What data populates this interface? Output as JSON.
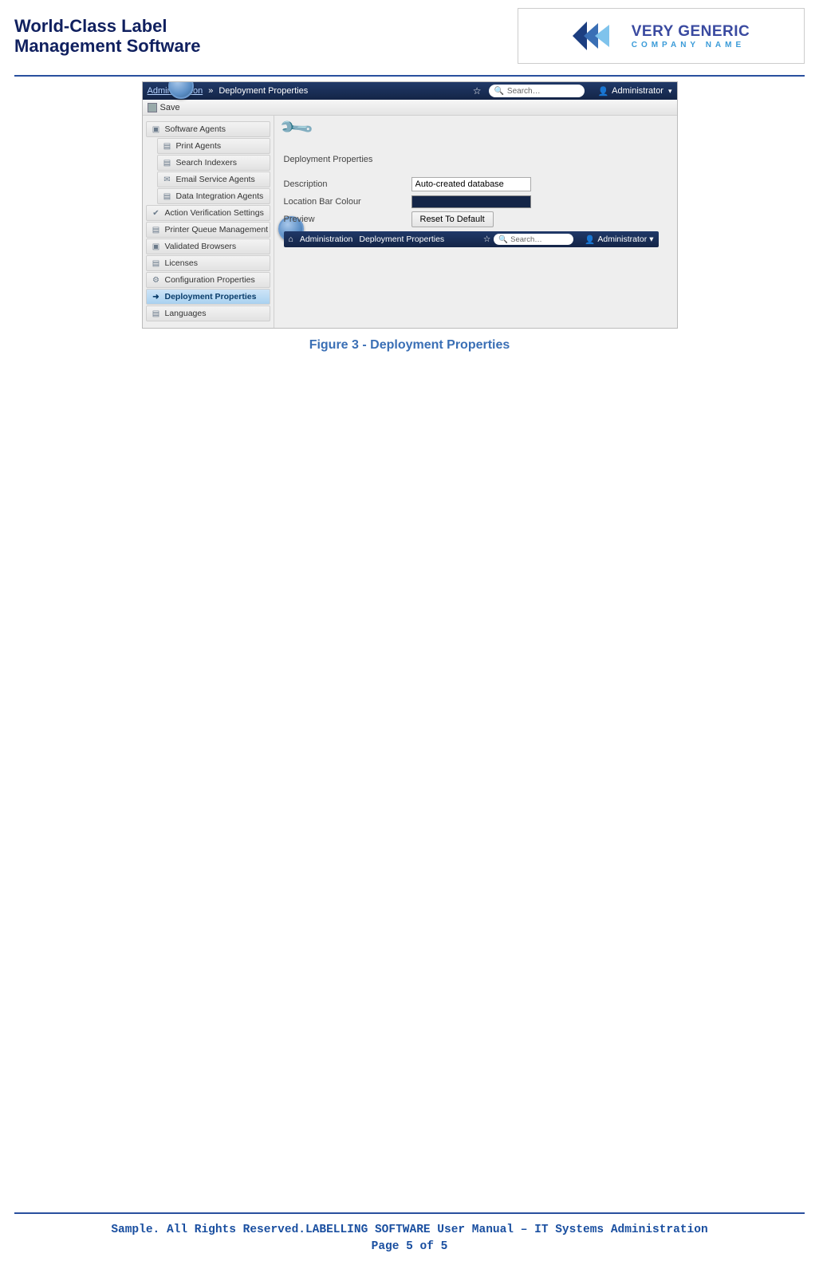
{
  "header": {
    "title_line1": "World-Class Label",
    "title_line2": "Management Software",
    "logo_line1": "VERY GENERIC",
    "logo_line2": "COMPANY NAME"
  },
  "screenshot": {
    "breadcrumb_admin": "Administration",
    "breadcrumb_current": "Deployment Properties",
    "search_placeholder": "Search…",
    "admin_label": "Administrator",
    "save_label": "Save",
    "sidebar": {
      "software_agents": "Software Agents",
      "print_agents": "Print Agents",
      "search_indexers": "Search Indexers",
      "email_service": "Email Service Agents",
      "data_integration": "Data Integration Agents",
      "action_verification": "Action Verification Settings",
      "printer_queue": "Printer Queue Management",
      "validated_browsers": "Validated Browsers",
      "licenses": "Licenses",
      "config_props": "Configuration Properties",
      "deploy_props": "Deployment Properties",
      "languages": "Languages"
    },
    "panel": {
      "title": "Deployment Properties",
      "description_label": "Description",
      "description_value": "Auto-created database",
      "colour_label": "Location Bar Colour",
      "preview_label": "Preview",
      "reset_button": "Reset To Default",
      "preview_admin": "Administration",
      "preview_current": "Deployment Properties",
      "preview_search": "Search…",
      "preview_user": "Administrator"
    }
  },
  "caption": "Figure 3 - Deployment Properties",
  "footer": {
    "line1": "Sample. All Rights Reserved.LABELLING SOFTWARE User Manual – IT Systems Administration",
    "line2": "Page 5 of 5"
  }
}
